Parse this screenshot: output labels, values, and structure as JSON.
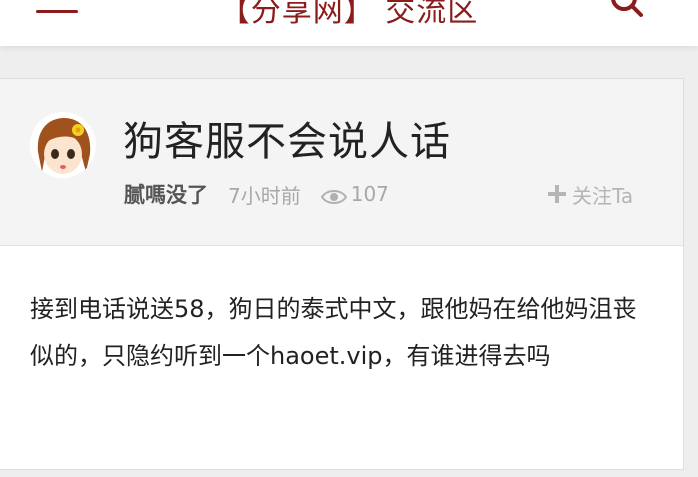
{
  "header": {
    "title": "【分享网】 交流区",
    "menu_icon": "menu-icon",
    "search_icon": "search-icon",
    "accent_color": "#8a1c1c"
  },
  "post": {
    "title": "狗客服不会说人话",
    "author": "腻嗎没了",
    "time": "7小时前",
    "views": "107",
    "follow_label": "关注Ta",
    "content": "接到电话说送58，狗日的泰式中文，跟他妈在给他妈沮丧似的，只隐约听到一个haoet.vip，有谁进得去吗"
  }
}
